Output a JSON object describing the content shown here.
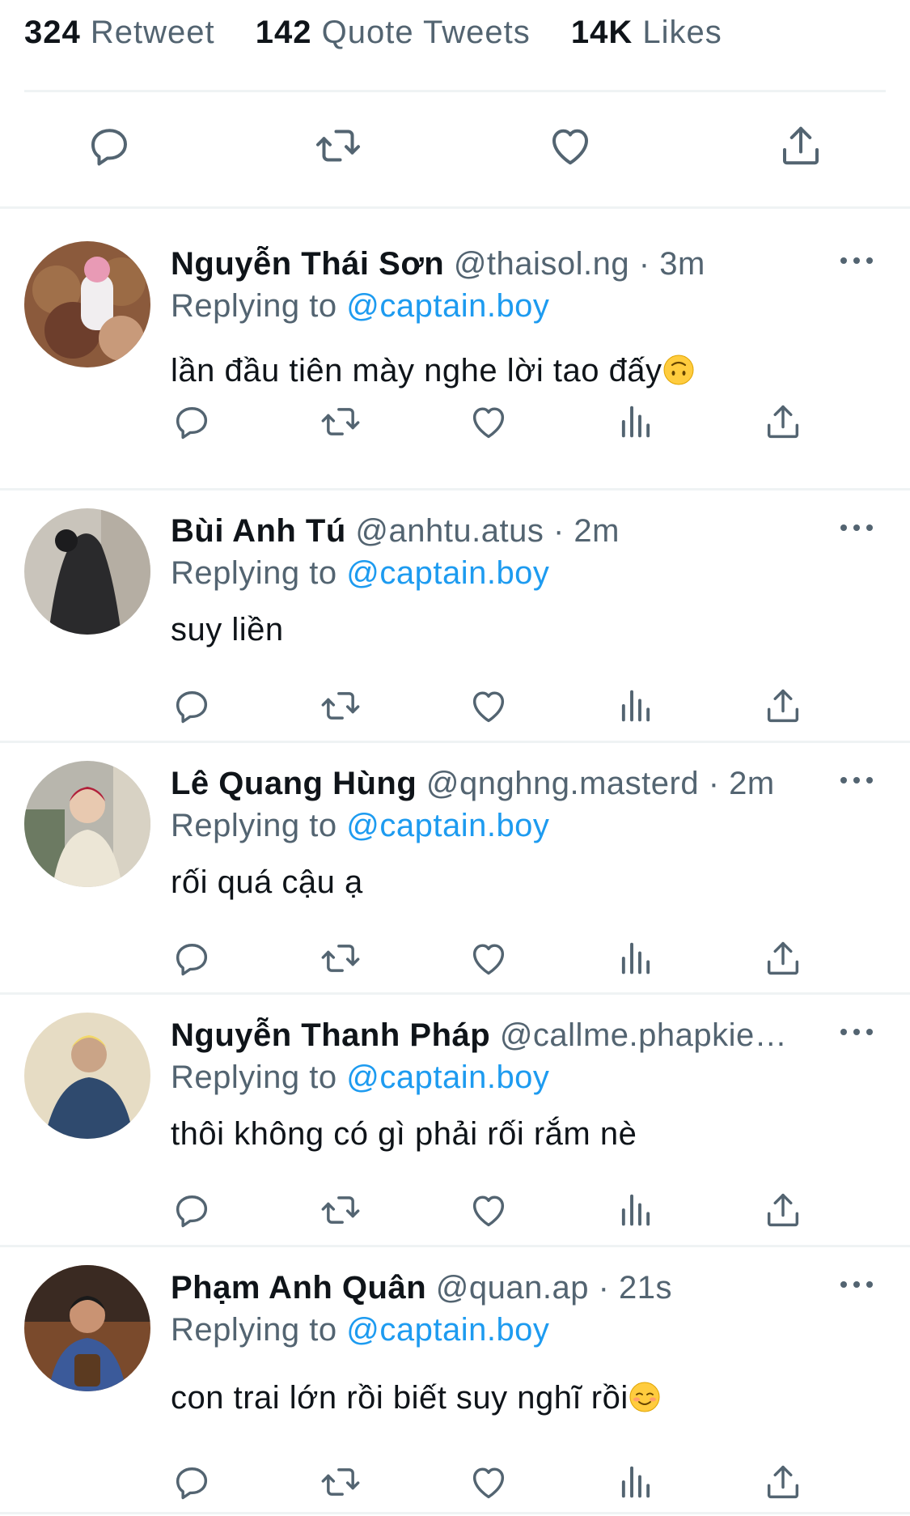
{
  "stats": {
    "retweets_count": "324",
    "retweets_label": "Retweet",
    "quotes_count": "142",
    "quotes_label": "Quote Tweets",
    "likes_count": "14K",
    "likes_label": "Likes"
  },
  "colors": {
    "accent": "#1d9bf0",
    "muted": "#536471",
    "text": "#0f1419",
    "divider": "#eff3f4"
  },
  "icons": {
    "reply": "reply-icon",
    "retweet": "retweet-icon",
    "like": "heart-icon",
    "share": "share-icon",
    "analytics": "analytics-icon",
    "more": "more-icon"
  },
  "replies": [
    {
      "name": "Nguyễn Thái Sơn",
      "handle": "@thaisol.ng",
      "dot": " · ",
      "time": "3m",
      "replying_prefix": "Replying to ",
      "replying_to": "@captain.boy",
      "text": "lần đầu tiên mày nghe lời tao đấy",
      "emoji": "upside-down-face"
    },
    {
      "name": "Bùi Anh Tú",
      "handle": " @anhtu.atus",
      "dot": " · ",
      "time": "2m",
      "replying_prefix": "Replying to ",
      "replying_to": "@captain.boy",
      "text": "suy liền",
      "emoji": ""
    },
    {
      "name": "Lê Quang Hùng",
      "handle": "@qnghng.masterd",
      "dot": " · ",
      "time": "2m",
      "replying_prefix": "Replying to ",
      "replying_to": "@captain.boy",
      "text": "rối quá cậu ạ",
      "emoji": ""
    },
    {
      "name": "Nguyễn Thanh Pháp",
      "handle": "@callme.phapkie…",
      "dot": "",
      "time": "",
      "replying_prefix": "Replying to ",
      "replying_to": "@captain.boy",
      "text": "thôi không có gì phải rối rắm nè",
      "emoji": ""
    },
    {
      "name": "Phạm Anh Quân",
      "handle": "@quan.ap",
      "dot": " · ",
      "time": "21s",
      "replying_prefix": "Replying to ",
      "replying_to": "@captain.boy",
      "text": "con trai lớn rồi biết suy nghĩ rồi",
      "emoji": "smiling-face"
    }
  ]
}
